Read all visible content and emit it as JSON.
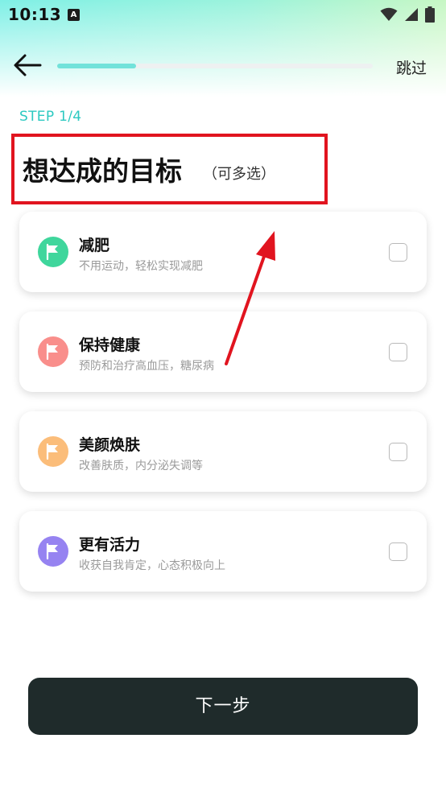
{
  "status_bar": {
    "time": "10:13",
    "notification_letter": "A"
  },
  "nav": {
    "skip_label": "跳过",
    "progress_fraction": 0.25
  },
  "step": {
    "label": "STEP 1/4"
  },
  "heading": {
    "title": "想达成的目标",
    "subtitle": "（可多选）"
  },
  "options": [
    {
      "title": "减肥",
      "subtitle": "不用运动，轻松实现减肥",
      "color": "#3fd69c",
      "checked": false
    },
    {
      "title": "保持健康",
      "subtitle": "预防和治疗高血压，糖尿病",
      "color": "#f98e8b",
      "checked": false
    },
    {
      "title": "美颜焕肤",
      "subtitle": "改善肤质，内分泌失调等",
      "color": "#fbbd7a",
      "checked": false
    },
    {
      "title": "更有活力",
      "subtitle": "收获自我肯定，心态积极向上",
      "color": "#9683f1",
      "checked": false
    }
  ],
  "icons": {
    "back": "arrow-left-icon",
    "option": "flag-icon",
    "wifi": "wifi-icon",
    "signal": "signal-icon",
    "battery": "battery-icon"
  },
  "footer": {
    "next_label": "下一步"
  },
  "annotation_color": "#e1141f"
}
